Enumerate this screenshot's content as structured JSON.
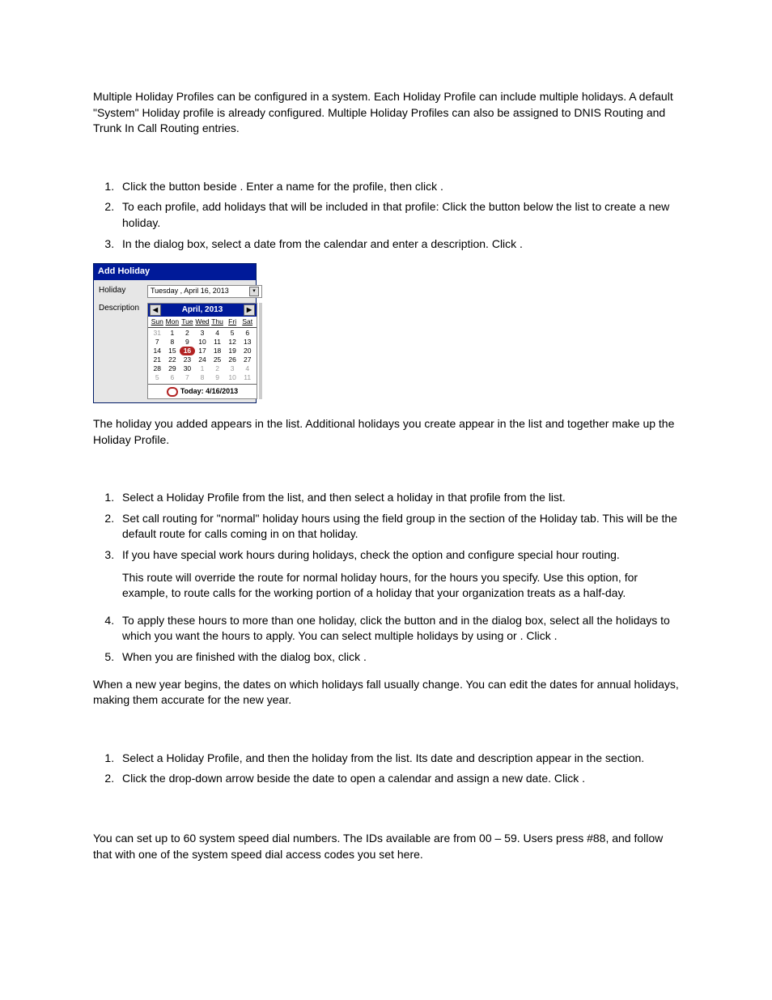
{
  "intro": "Multiple Holiday Profiles can be configured in a system. Each Holiday Profile can include multiple holidays. A default \"System\" Holiday profile is already configured. Multiple Holiday Profiles can also be assigned to DNIS Routing and Trunk In Call Routing entries.",
  "steps1": {
    "i1": "Click the           button beside            . Enter a name for the profile, then click        .",
    "i2": "To each profile, add holidays that will be included in that profile: Click the          button below the list to create a new holiday.",
    "i3": "In the dialog box, select a date from the calendar and enter a description. Click      ."
  },
  "dialog": {
    "title": "Add Holiday",
    "labelHoliday": "Holiday",
    "labelDescription": "Description",
    "dateText": "Tuesday  ,     April      16, 2013",
    "calHeader": "April, 2013",
    "dow": [
      "Sun",
      "Mon",
      "Tue",
      "Wed",
      "Thu",
      "Fri",
      "Sat"
    ],
    "weeks": [
      [
        {
          "d": "31",
          "dim": true
        },
        {
          "d": "1"
        },
        {
          "d": "2"
        },
        {
          "d": "3"
        },
        {
          "d": "4"
        },
        {
          "d": "5"
        },
        {
          "d": "6"
        }
      ],
      [
        {
          "d": "7"
        },
        {
          "d": "8"
        },
        {
          "d": "9"
        },
        {
          "d": "10"
        },
        {
          "d": "11"
        },
        {
          "d": "12"
        },
        {
          "d": "13"
        }
      ],
      [
        {
          "d": "14"
        },
        {
          "d": "15"
        },
        {
          "d": "16",
          "sel": true
        },
        {
          "d": "17"
        },
        {
          "d": "18"
        },
        {
          "d": "19"
        },
        {
          "d": "20"
        }
      ],
      [
        {
          "d": "21"
        },
        {
          "d": "22"
        },
        {
          "d": "23"
        },
        {
          "d": "24"
        },
        {
          "d": "25"
        },
        {
          "d": "26"
        },
        {
          "d": "27"
        }
      ],
      [
        {
          "d": "28"
        },
        {
          "d": "29"
        },
        {
          "d": "30"
        },
        {
          "d": "1",
          "dim": true
        },
        {
          "d": "2",
          "dim": true
        },
        {
          "d": "3",
          "dim": true
        },
        {
          "d": "4",
          "dim": true
        }
      ],
      [
        {
          "d": "5",
          "dim": true
        },
        {
          "d": "6",
          "dim": true
        },
        {
          "d": "7",
          "dim": true
        },
        {
          "d": "8",
          "dim": true
        },
        {
          "d": "9",
          "dim": true
        },
        {
          "d": "10",
          "dim": true
        },
        {
          "d": "11",
          "dim": true
        }
      ]
    ],
    "today": "Today: 4/16/2013"
  },
  "afterDialog": "The holiday you added appears in the              list. Additional holidays you create appear in the list and together make up the Holiday Profile.",
  "steps2": {
    "i1": "Select a Holiday Profile from the             list, and then select a holiday in that profile from the              list.",
    "i2": "Set call routing for \"normal\" holiday hours using the field group in the              section of the Holiday tab. This will be the default route for calls coming in on that holiday.",
    "i3": "If you have special work hours during holidays, check the                         option and configure special hour routing.",
    "i3b": "This route will override the route for normal holiday hours, for the hours you specify. Use this option, for example, to route calls for the working portion of a holiday that your organization treats as a half-day.",
    "i4": "To apply these hours to more than one holiday, click the                  button and in the                   dialog box, select all the holidays to which you want the hours to apply. You can select multiple holidays by using                 or                    . Click       .",
    "i5": "When you are finished with the dialog box, click      ."
  },
  "afterSteps2": "When a new year begins, the dates on which holidays fall usually change. You can edit the dates for annual holidays, making them accurate for the new year.",
  "steps3": {
    "i1": "Select a Holiday Profile, and then the holiday from the              list. Its date and description appear in the              section.",
    "i2": "Click the drop-down arrow beside the date to open a calendar and assign a new date. Click            ."
  },
  "outro": "You can set up to 60 system speed dial numbers. The IDs available are from 00 – 59. Users press #88, and follow that with one of the system speed dial access codes you set here."
}
